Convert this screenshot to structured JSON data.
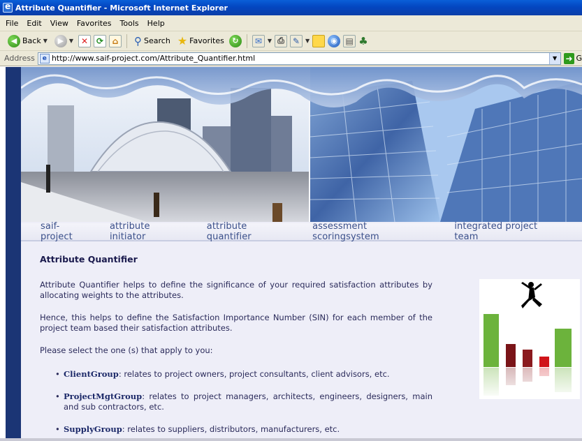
{
  "window": {
    "title": "Attribute Quantifier - Microsoft Internet Explorer"
  },
  "menu": [
    "File",
    "Edit",
    "View",
    "Favorites",
    "Tools",
    "Help"
  ],
  "toolbar": {
    "back_label": "Back",
    "search_label": "Search",
    "favorites_label": "Favorites"
  },
  "address": {
    "label": "Address",
    "url": "http://www.saif-project.com/Attribute_Quantifier.html",
    "go_label": "G"
  },
  "nav": [
    {
      "label": "saif-project"
    },
    {
      "label": "attribute initiator"
    },
    {
      "label": "attribute quantifier"
    },
    {
      "label": "assessment scoringsystem"
    },
    {
      "label": "integrated project team"
    }
  ],
  "content": {
    "heading": "Attribute Quantifier",
    "para1": "Attribute Quantifier helps to define the significance of your required satisfaction attributes by allocating weights to the attributes.",
    "para2": "Hence, this helps to define the Satisfaction Importance Number (SIN) for each member of the project team based their satisfaction attributes.",
    "para3": "Please select the one (s) that apply to you:",
    "groups": [
      {
        "name": "ClientGroup",
        "desc": ": relates to project owners, project consultants, client advisors, etc."
      },
      {
        "name": "ProjectMgtGroup",
        "desc": ": relates to project managers, architects, engineers, designers, main and sub contractors, etc."
      },
      {
        "name": "SupplyGroup",
        "desc": ": relates to suppliers, distributors, manufacturers, etc."
      }
    ]
  },
  "colors": {
    "rail": "#1b3575",
    "nav_text": "#3a4f8a",
    "bar_green": "#6cb33c",
    "bar_dark_red": "#7a1418",
    "bar_red": "#d0141a"
  }
}
